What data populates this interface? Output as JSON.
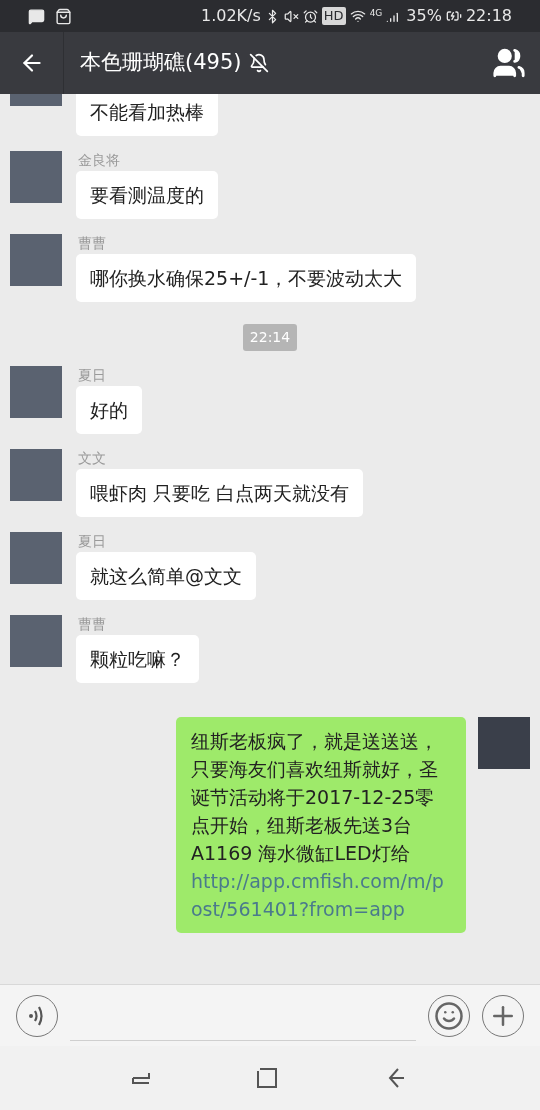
{
  "status_bar": {
    "speed": "1.02K/s",
    "hd": "HD",
    "network": "4G",
    "battery": "35%",
    "time": "22:18"
  },
  "header": {
    "title": "本色珊瑚礁(495)",
    "muted": true
  },
  "messages": [
    {
      "kind": "incoming",
      "text": "不能看加热棒"
    },
    {
      "kind": "incoming",
      "sender": "金良将",
      "text": "要看测温度的"
    },
    {
      "kind": "incoming",
      "sender": "曹曹",
      "text": "哪你换水确保25+/-1，不要波动太大"
    },
    {
      "kind": "time",
      "text": "22:14"
    },
    {
      "kind": "incoming",
      "sender": "夏日",
      "text": "好的"
    },
    {
      "kind": "incoming",
      "sender": "文文",
      "text": "喂虾肉 只要吃 白点两天就没有"
    },
    {
      "kind": "incoming",
      "sender": "夏日",
      "text": "就这么简单@文文"
    },
    {
      "kind": "incoming",
      "sender": "曹曹",
      "text": "颗粒吃嘛？"
    },
    {
      "kind": "outgoing",
      "text": "纽斯老板疯了，就是送送送，只要海友们喜欢纽斯就好，圣诞节活动将于2017-12-25零点开始，纽斯老板先送3台A1169 海水微缸LED灯给",
      "link": "http://app.cmfish.com/m/post/561401?from=app"
    }
  ]
}
